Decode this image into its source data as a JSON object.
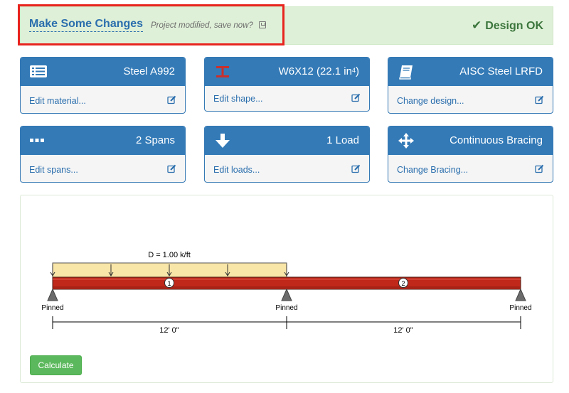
{
  "status": {
    "project_link": "Make Some Changes",
    "save_note": "Project modified, save now?",
    "design_status": "Design OK",
    "highlight_color": "#e8231e",
    "ok_color": "#3c763d"
  },
  "cards": {
    "material": {
      "title": "Steel A992",
      "link": "Edit material...",
      "icon": "list-icon"
    },
    "shape": {
      "title": "W6X12 (22.1 in",
      "title_sup": "4",
      "title_close": ")",
      "link": "Edit shape...",
      "icon": "i-beam-icon"
    },
    "design": {
      "title": "AISC Steel LRFD",
      "link": "Change design...",
      "icon": "book-icon"
    },
    "spans": {
      "title": "2 Spans",
      "link": "Edit spans...",
      "icon": "ellipsis-icon"
    },
    "loads": {
      "title": "1 Load",
      "link": "Edit loads...",
      "icon": "arrow-down-icon"
    },
    "bracing": {
      "title": "Continuous Bracing",
      "link": "Change Bracing...",
      "icon": "move-icon"
    }
  },
  "beam": {
    "load_label": "D = 1.00 k/ft",
    "span_numbers": [
      "1",
      "2"
    ],
    "supports": [
      "Pinned",
      "Pinned",
      "Pinned"
    ],
    "span_lengths": [
      "12' 0\"",
      "12' 0\""
    ],
    "beam_color": "#c0281a",
    "load_color": "#f8e6a8"
  },
  "actions": {
    "calculate": "Calculate"
  }
}
